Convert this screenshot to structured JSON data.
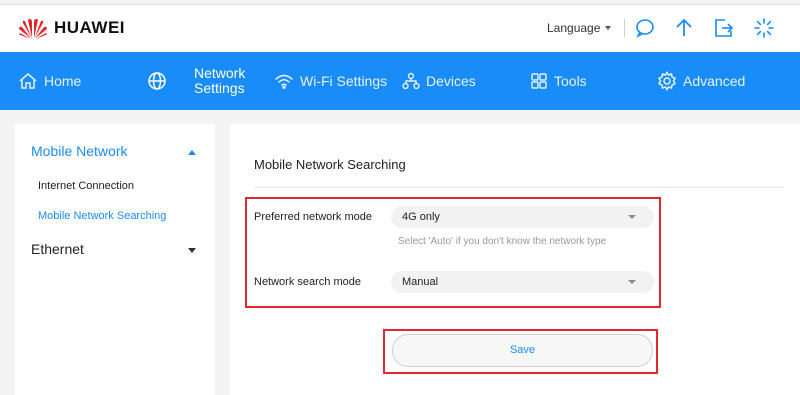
{
  "brand": {
    "name": "HUAWEI",
    "color": "#e0282e"
  },
  "header": {
    "language_label": "Language",
    "icons": [
      "message-icon",
      "update-arrow-icon",
      "logout-icon",
      "loading-icon"
    ]
  },
  "nav": {
    "accent": "#1a8cf7",
    "items": [
      {
        "label": "Home",
        "icon": "home-icon"
      },
      {
        "label": "",
        "icon": "globe-icon"
      },
      {
        "label_line1": "Network",
        "label_line2": "Settings",
        "active": true
      },
      {
        "label": "Wi-Fi Settings",
        "icon": "wifi-icon"
      },
      {
        "label": "Devices",
        "icon": "devices-icon"
      },
      {
        "label": "Tools",
        "icon": "tools-icon"
      },
      {
        "label": "Advanced",
        "icon": "gear-icon"
      }
    ]
  },
  "sidebar": {
    "groups": [
      {
        "label": "Mobile Network",
        "expanded": true,
        "items": [
          {
            "label": "Internet Connection",
            "active": false
          },
          {
            "label": "Mobile Network Searching",
            "active": true
          }
        ]
      },
      {
        "label": "Ethernet",
        "expanded": false
      }
    ]
  },
  "content": {
    "title": "Mobile Network Searching",
    "fields": [
      {
        "label": "Preferred network mode",
        "value": "4G only",
        "hint": "Select 'Auto' if you don't know the network type"
      },
      {
        "label": "Network search mode",
        "value": "Manual"
      }
    ],
    "save_label": "Save",
    "highlight_color": "#e0282e"
  }
}
